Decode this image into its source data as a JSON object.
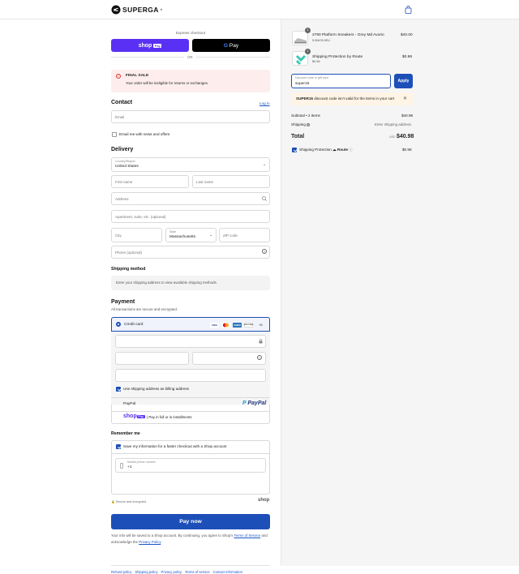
{
  "brand": {
    "name": "SUPERGA",
    "superscript": "®"
  },
  "express": {
    "title": "Express checkout",
    "shop_pay_label": "shop",
    "shop_pay_badge": "Pay",
    "gpay_label": "Pay",
    "or_label": "OR"
  },
  "alert": {
    "title": "FINAL SALE",
    "message": "Your order will be ineligible for returns or exchanges."
  },
  "contact": {
    "heading": "Contact",
    "login_link": "Log in",
    "email_placeholder": "Email",
    "newsletter_label": "Email me with news and offers",
    "newsletter_checked": false
  },
  "delivery": {
    "heading": "Delivery",
    "country_label": "Country/Region",
    "country_value": "United States",
    "first_name_placeholder": "First name",
    "last_name_placeholder": "Last name",
    "address_placeholder": "Address",
    "apartment_placeholder": "Apartment, suite, etc. (optional)",
    "city_placeholder": "City",
    "state_label": "State",
    "state_value": "Massachusetts",
    "zip_placeholder": "ZIP code",
    "phone_placeholder": "Phone (optional)"
  },
  "shipping_method": {
    "heading": "Shipping method",
    "message": "Enter your shipping address to view available shipping methods."
  },
  "payment": {
    "heading": "Payment",
    "subtitle": "All transactions are secure and encrypted.",
    "credit_card_label": "Credit card",
    "card_brands": [
      "VISA",
      "MC",
      "AMEX",
      "DISCOVER"
    ],
    "more_brands": "+6",
    "billing_same_label": "Use shipping address as billing address",
    "billing_same_checked": true,
    "paypal_label": "PayPal",
    "paypal_logo_text": "PayPal",
    "shoppay_logo": "shop",
    "shoppay_badge": "Pay",
    "shoppay_text": "| Pay in full or in installments"
  },
  "remember": {
    "heading": "Remember me",
    "save_label": "Save my information for a faster checkout with a Shop account",
    "save_checked": true,
    "mobile_label": "Mobile phone number",
    "mobile_value": "+1",
    "secure_label": "Secure and encrypted",
    "shop_logo": "shop"
  },
  "pay_now_label": "Pay now",
  "legal": {
    "text1": "Your info will be saved to a Shop account. By continuing, you agree to Shop's",
    "terms_link": "Terms of Service",
    "text2": "and acknowledge the",
    "privacy_link": "Privacy Policy",
    "period": "."
  },
  "footer_links": [
    "Refund policy",
    "Shipping policy",
    "Privacy policy",
    "Terms of service",
    "Contact information"
  ],
  "order": {
    "items": [
      {
        "qty": "1",
        "name": "2790 Platform Sneakers - Grey Md Avorio",
        "variant": "5.5M/05.5EU",
        "price": "$40.00"
      },
      {
        "qty": "1",
        "name": "Shipping Protection by Route",
        "variant": "$0.98",
        "price": "$0.98"
      }
    ],
    "discount_label": "Discount code or gift card",
    "discount_value": "super15",
    "apply_label": "Apply",
    "discount_error_code": "SUPER15",
    "discount_error_text": "discount code isn't valid for the items in your cart",
    "subtotal_label": "Subtotal • 2 items",
    "subtotal_value": "$40.98",
    "shipping_label": "Shipping",
    "shipping_value": "Enter shipping address",
    "total_label": "Total",
    "total_currency": "USD",
    "total_value": "$40.98",
    "protection_label": "Shipping Protection",
    "protection_brand": "Route",
    "protection_price": "$0.98",
    "protection_checked": true
  },
  "colors": {
    "shop_pay": "#5a31f4",
    "primary": "#1c4fb8",
    "alert_bg": "#fdeeed",
    "error_bg": "#fff4e5"
  }
}
